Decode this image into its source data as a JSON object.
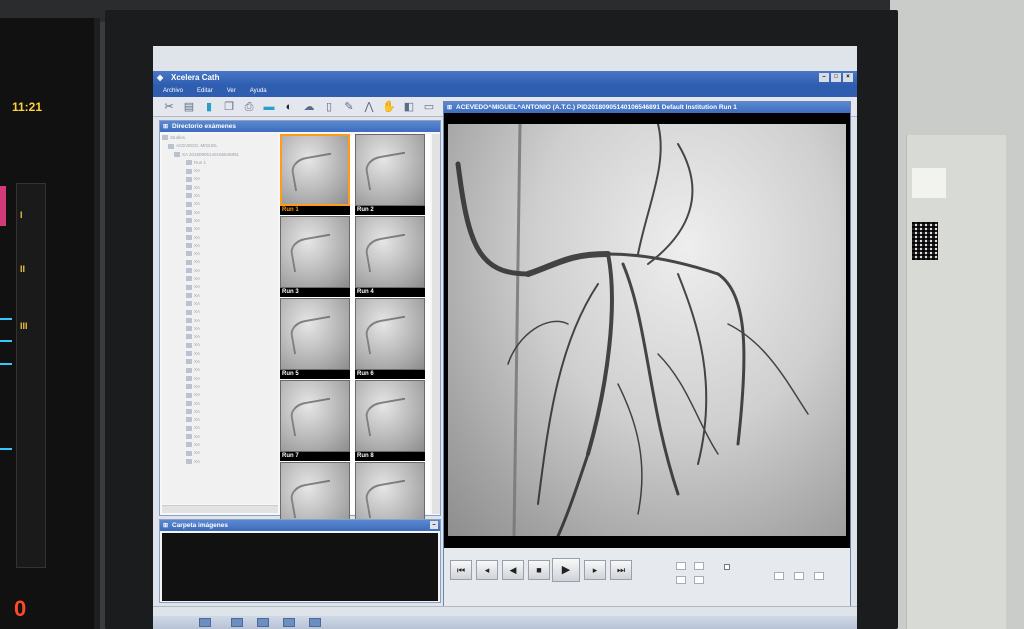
{
  "vitals_monitor": {
    "clock": "11:21",
    "leads": [
      "I",
      "II",
      "III"
    ],
    "big_value": "0"
  },
  "app": {
    "title": "Xcelera Cath",
    "menu": [
      "Archivo",
      "Editar",
      "Ver",
      "Ayuda"
    ]
  },
  "directory_panel": {
    "title": "Directorio exámenes",
    "tree_root": "Studies",
    "patient_node": "ACEVEDO, MIGUEL",
    "study_node": "XA 20180905140106546891",
    "run_node": "Run 1",
    "series_prefix": "XA"
  },
  "thumbnails": [
    "Run 1",
    "Run 2",
    "Run 3",
    "Run 4",
    "Run 5",
    "Run 6",
    "Run 7",
    "Run 8"
  ],
  "selected_run": "Run 1",
  "carpeta_panel": {
    "title": "Carpeta imágenes"
  },
  "viewer": {
    "title": "ACEVEDO^MIGUEL^ANTONIO (A.T.C.) PID20180905140106546891  Default Institution Run 1"
  },
  "playback": {
    "controls": [
      "first",
      "prev-frame",
      "prev",
      "stop",
      "play",
      "next-frame",
      "last"
    ]
  },
  "colors": {
    "title_blue": "#2f5db0",
    "selection_orange": "#ff9b1a",
    "clock_yellow": "#ffd23a"
  }
}
